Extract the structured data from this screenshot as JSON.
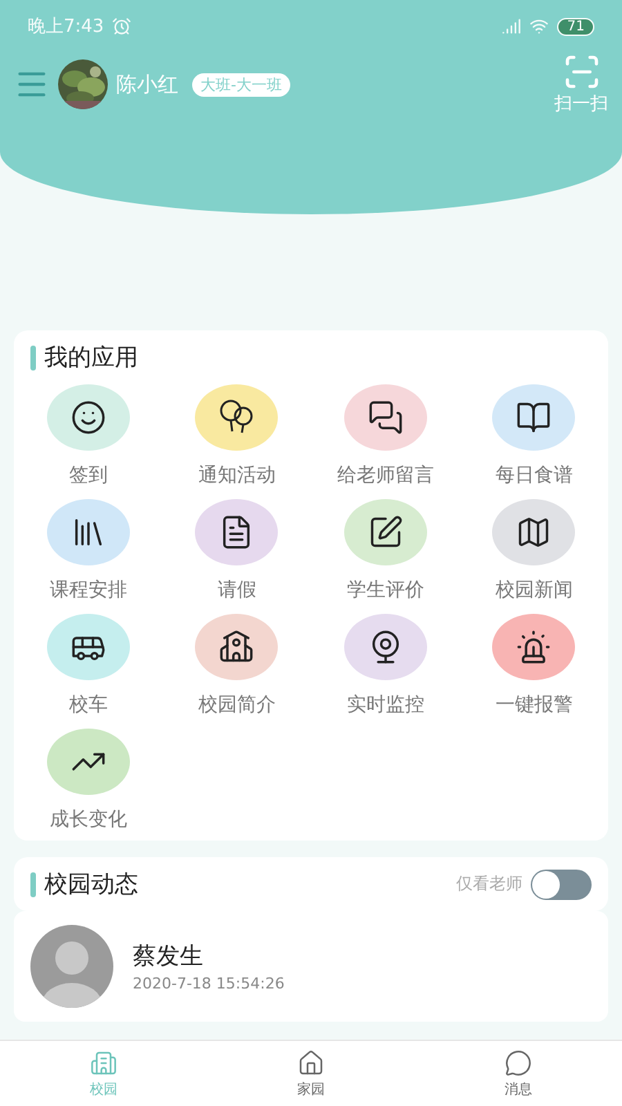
{
  "status_bar": {
    "time": "晚上7:43",
    "battery": "71"
  },
  "header": {
    "user_name": "陈小红",
    "class_tag": "大班-大一班",
    "scan_label": "扫一扫"
  },
  "apps": {
    "title": "我的应用",
    "items": [
      {
        "label": "签到",
        "color": "#d4efe6"
      },
      {
        "label": "通知活动",
        "color": "#f9e9a0"
      },
      {
        "label": "给老师留言",
        "color": "#f6d7da"
      },
      {
        "label": "每日食谱",
        "color": "#d3e8f8"
      },
      {
        "label": "课程安排",
        "color": "#d0e7f8"
      },
      {
        "label": "请假",
        "color": "#e6d9ee"
      },
      {
        "label": "学生评价",
        "color": "#d7ecd0"
      },
      {
        "label": "校园新闻",
        "color": "#e0e1e5"
      },
      {
        "label": "校车",
        "color": "#c5eeee"
      },
      {
        "label": "校园简介",
        "color": "#f3d6cf"
      },
      {
        "label": "实时监控",
        "color": "#e6dcef"
      },
      {
        "label": "一键报警",
        "color": "#f8b4b3"
      },
      {
        "label": "成长变化",
        "color": "#cce8c3"
      }
    ]
  },
  "feed": {
    "title": "校园动态",
    "filter_label": "仅看老师",
    "teachers_only": {
      "on": false
    },
    "posts": [
      {
        "author": "蔡发生",
        "time": "2020-7-18 15:54:26"
      }
    ]
  },
  "bottom_nav": [
    {
      "label": "校园",
      "selected": true
    },
    {
      "label": "家园",
      "selected": false
    },
    {
      "label": "消息",
      "selected": false
    }
  ]
}
